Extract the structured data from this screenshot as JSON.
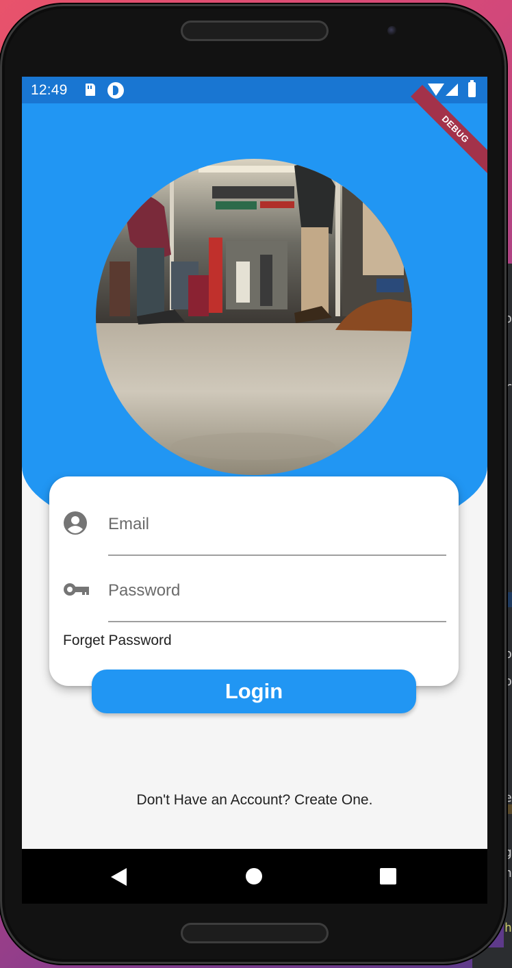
{
  "status_bar": {
    "time": "12:49",
    "icons": [
      "sd-card-icon",
      "notification-icon",
      "wifi-icon",
      "signal-icon",
      "battery-icon"
    ],
    "background": "#1976d2"
  },
  "debug_banner": {
    "label": "DEBUG",
    "color": "#a3324a"
  },
  "header": {
    "background": "#2196f3",
    "image": "train-interior-photo"
  },
  "form": {
    "email": {
      "placeholder": "Email",
      "icon": "account-circle-icon"
    },
    "password": {
      "placeholder": "Password",
      "icon": "key-icon"
    },
    "forget_label": "Forget Password"
  },
  "login": {
    "label": "Login",
    "color": "#2196f3"
  },
  "signup_text": "Don't Have an Account? Create One.",
  "nav": {
    "buttons": [
      "back-icon",
      "home-icon",
      "recents-icon"
    ]
  }
}
